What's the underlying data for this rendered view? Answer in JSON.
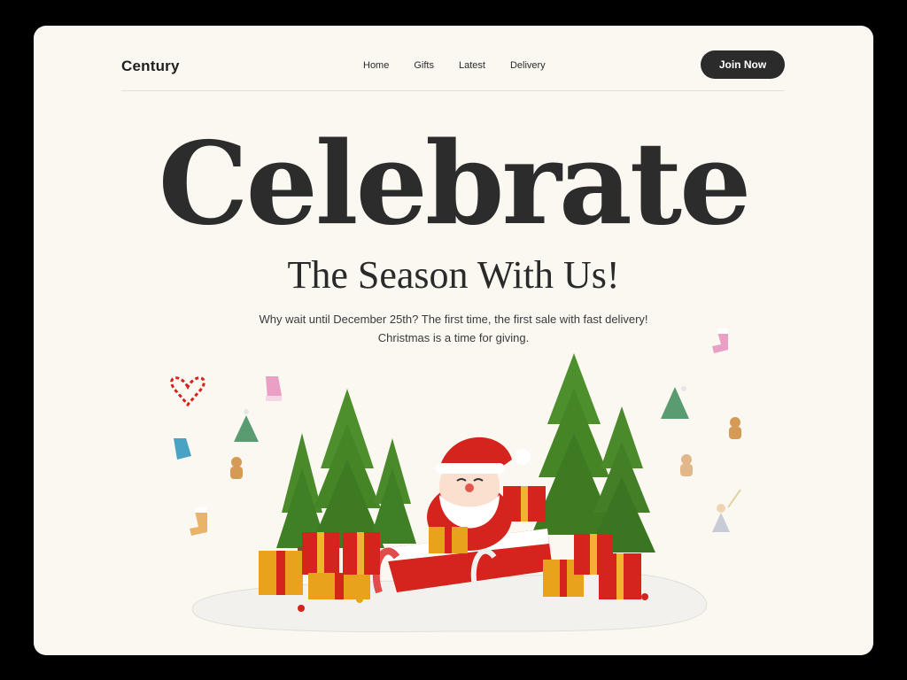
{
  "nav": {
    "brand": "Century",
    "links": [
      "Home",
      "Gifts",
      "Latest",
      "Delivery"
    ],
    "cta": "Join Now"
  },
  "hero": {
    "title": "Celebrate",
    "subtitle": "The Season With Us!",
    "text_line1": "Why wait until December 25th? The first time, the first sale with fast delivery!",
    "text_line2": "Christmas is a time for giving."
  },
  "icons": [
    "candy-cane-heart-icon",
    "mitten-pink-icon",
    "mitten-blue-icon",
    "mini-tree-icon",
    "gingerbread-icon",
    "stocking-icon",
    "angel-icon"
  ],
  "colors": {
    "accent": "#2b2b2b",
    "background": "#fbf8f2",
    "tree": "#4e8a2c",
    "gift": "#d4241d"
  }
}
